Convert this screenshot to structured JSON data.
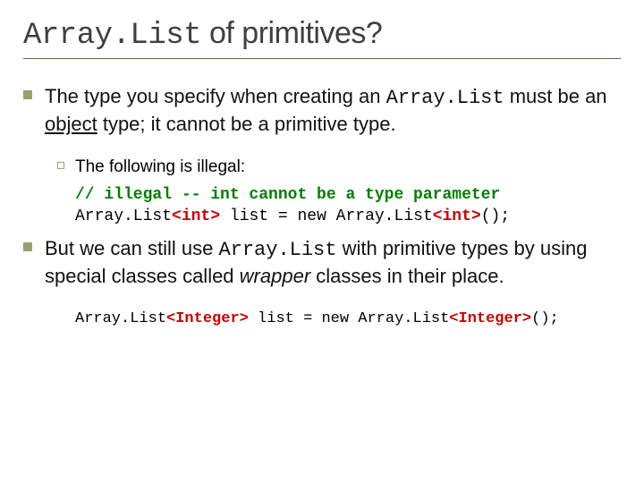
{
  "title": {
    "code": "Array.List",
    "rest": " of primitives?"
  },
  "bullet1": {
    "pre": "The type you specify when creating an ",
    "code": "Array.List",
    "mid": " must be an ",
    "underlined": "object",
    "post": " type; it cannot be a primitive type."
  },
  "sub1": {
    "text": "The following is illegal:"
  },
  "code1": {
    "comment": "// illegal -- int cannot be a type parameter",
    "line_a": "Array.List",
    "line_b": "<int>",
    "line_c": " list = new Array.List",
    "line_d": "<int>",
    "line_e": "();"
  },
  "bullet2": {
    "pre": "But we can still use ",
    "code": "Array.List",
    "mid": " with primitive types by using special classes called ",
    "italic": "wrapper",
    "post": " classes in their place."
  },
  "code2": {
    "a": "Array.List",
    "b": "<Integer>",
    "c": " list = new Array.List",
    "d": "<Integer>",
    "e": "();"
  }
}
